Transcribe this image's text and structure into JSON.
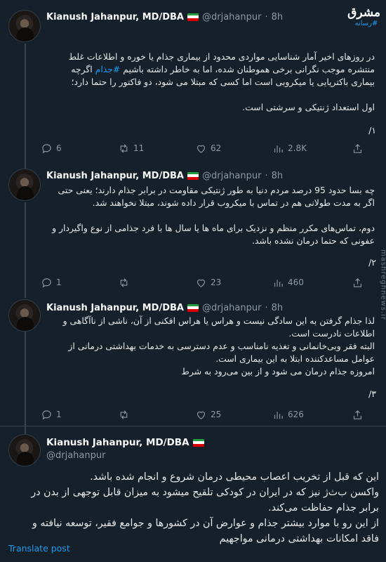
{
  "logo": {
    "text": "مشرق",
    "hashtag": "#رسانه"
  },
  "watermark": "mashreghnews.ir",
  "tweets": [
    {
      "name": "Kianush Jahanpur, MD/DBA",
      "handle": "@drjahanpur",
      "dot": "·",
      "time": "8h",
      "lines": [
        "در روزهای اخیر آمار شناسایی مواردی محدود از بیماری جذام یا خوره و اطلاعات غلط",
        "منتشره موجب نگرانی برخی هموطنان شده، اما به خاطر داشته باشیم",
        "بیماری باکتریایی یا میکروبی است اما کسی که مبتلا می شود، دو فاکتور را حتما دارد؛",
        "",
        "اول استعداد ژنتیکی و سرشتی است."
      ],
      "hashtag": "#جذام",
      "hashtag_after": "اگرچه",
      "counter": "۱/",
      "replies": "6",
      "reposts": "11",
      "likes": "62",
      "views": "2.8K"
    },
    {
      "name": "Kianush Jahanpur, MD/DBA",
      "handle": "@drjahanpur",
      "dot": "·",
      "time": "8h",
      "lines": [
        "چه بسا حدود 95 درصد مردم دنیا به طور ژنتیکی مقاومت در برابر جذام دارند؛ یعنی حتی",
        "اگر به مدت طولانی هم در تماس با میکروب قرار داده شوند، مبتلا نخواهند شد.",
        "",
        "دوم، تماس‌های مکرر منظم و نزدیک  برای ماه ها یا سال ها با فرد جذامی از نوع واگیردار و",
        "عفونی که حتما درمان نشده باشد."
      ],
      "counter": "۲/",
      "replies": "1",
      "reposts": "",
      "likes": "23",
      "views": "460"
    },
    {
      "name": "Kianush Jahanpur, MD/DBA",
      "handle": "@drjahanpur",
      "dot": "·",
      "time": "8h",
      "lines": [
        "لذا جذام گرفتن به این سادگی نیست و هراس  یا هراس افکنی از آن، ناشی از ناآگاهی و",
        "اطلاعات نادرست است.",
        "البته فقر وبی‌خانمانی و تغذیه نامناسب و عدم دسترسی به خدمات بهداشتی درمانی از",
        "عوامل مساعدکننده ابتلا به این بیماری است.",
        "امروزه جذام درمان می شود و از بین می‌رود به شرط"
      ],
      "counter": "۳/",
      "replies": "1",
      "reposts": "",
      "likes": "25",
      "views": "626"
    }
  ],
  "main_tweet": {
    "name": "Kianush Jahanpur, MD/DBA",
    "handle": "@drjahanpur",
    "lines": [
      "این که قبل از تخریب اعصاب محیطی درمان شروع و انجام شده باشد.",
      "واکسن ب‌ث‌ژ نیز که در ایران در کودکی تلقیح میشود به میزان قابل توجهی از بدن در",
      "برابر جذام حفاظت می‌کند.",
      "از این رو با موارد بیشتر جذام و عوارض آن در کشورها و جوامع فقیر، توسعه نیافته و",
      "فاقد امکانات بهداشتی درمانی مواجهیم"
    ],
    "translate": "Translate post"
  }
}
